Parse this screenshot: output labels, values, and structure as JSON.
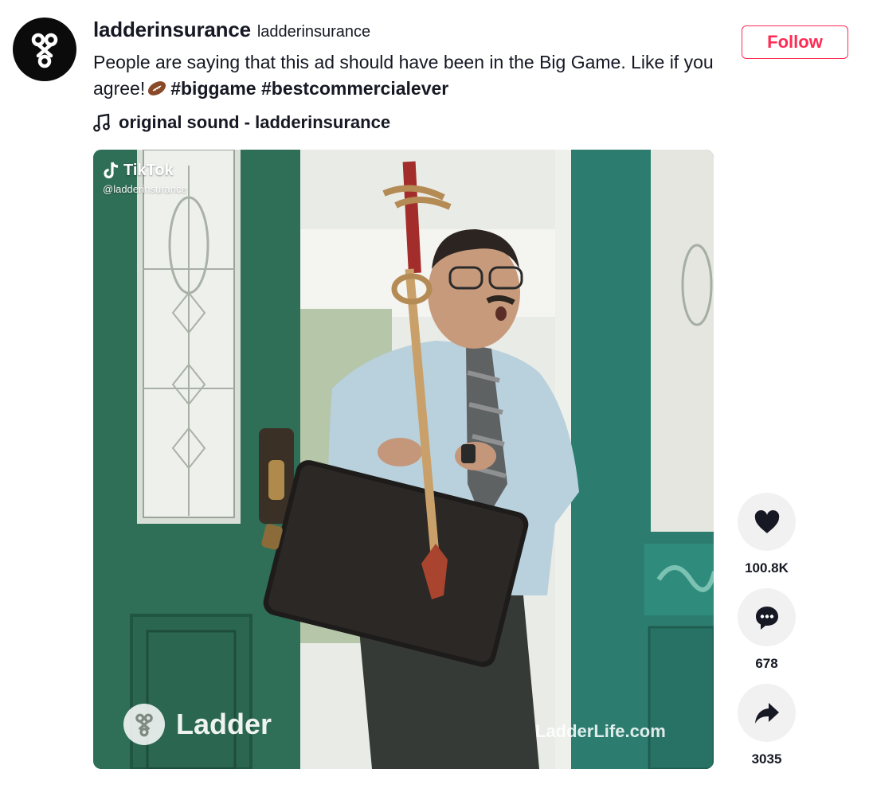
{
  "author": {
    "name": "ladderinsurance",
    "handle": "ladderinsurance",
    "avatar_icon": "ladder-logo-icon"
  },
  "description": {
    "text": "People are saying that this ad should have been in the Big Game. Like if you agree!",
    "emoji_icon": "american-football-icon",
    "hashtags": [
      "#biggame",
      "#bestcommercialever"
    ]
  },
  "music": {
    "icon": "music-note-icon",
    "label": "original sound - ladderinsurance"
  },
  "follow_button": {
    "label": "Follow",
    "color": "#fe2c55"
  },
  "video": {
    "watermark_brand": "TikTok",
    "watermark_handle": "@ladderinsurance",
    "overlay_brand": "Ladder",
    "overlay_url": "LadderLife.com"
  },
  "actions": {
    "like": {
      "icon": "heart-icon",
      "count": "100.8K"
    },
    "comment": {
      "icon": "comment-icon",
      "count": "678"
    },
    "share": {
      "icon": "share-icon",
      "count": "3035"
    }
  }
}
